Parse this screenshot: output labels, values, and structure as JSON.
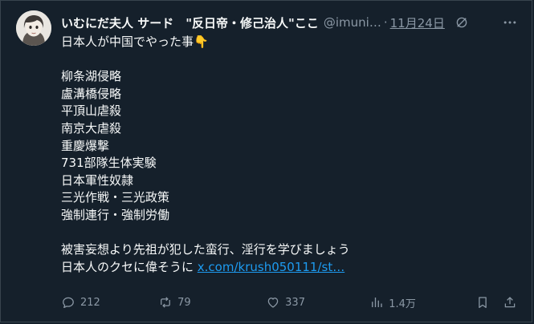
{
  "tweet": {
    "display_name": "いむにだ夫人 サード　\"反日帝・修己治人\"ここ",
    "handle": "@imunida",
    "separator": "·",
    "date": "11月24日",
    "body_lines": [
      "日本人が中国でやった事👇",
      "",
      "柳条湖侵略",
      "盧溝橋侵略",
      "平頂山虐殺",
      "南京大虐殺",
      "重慶爆撃",
      "731部隊生体実験",
      "日本軍性奴隷",
      "三光作戦・三光政策",
      "強制連行・強制労働",
      "",
      "被害妄想より先祖が犯した蛮行、淫行を学びましょう"
    ],
    "last_line_text": "日本人のクセに偉そうに ",
    "link_text": "x.com/krush050111/st…"
  },
  "actions": {
    "reply_count": "212",
    "retweet_count": "79",
    "like_count": "337",
    "view_count": "1.4万"
  },
  "icons": {
    "avatar": "avatar-illustration",
    "grok": "grok-icon",
    "more": "more-icon",
    "reply": "reply-icon",
    "retweet": "retweet-icon",
    "like": "heart-icon",
    "views": "views-icon",
    "bookmark": "bookmark-icon",
    "share": "share-icon"
  },
  "colors": {
    "background": "#15202b",
    "text": "#f7f9f9",
    "muted": "#8b98a5",
    "link": "#1d9bf0",
    "border": "#38444d"
  }
}
